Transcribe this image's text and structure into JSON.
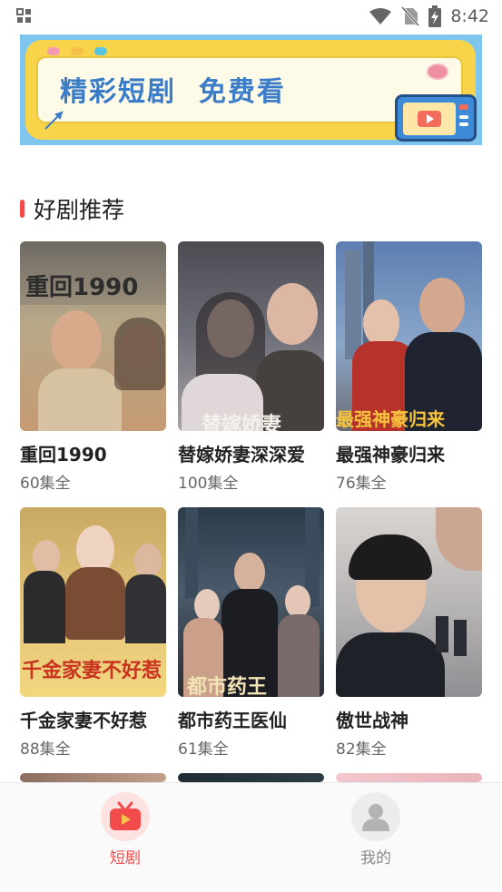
{
  "status_bar": {
    "time": "8:42",
    "icons": [
      "gallery-icon",
      "wifi-icon",
      "no-sim-icon",
      "battery-charging-icon"
    ]
  },
  "banner": {
    "text": "精彩短剧  免费看",
    "colors": {
      "frame": "#7fc6ee",
      "yellow": "#f8d44b",
      "text": "#3b7cc9"
    }
  },
  "section": {
    "title": "好剧推荐",
    "accent_color": "#f24b4b"
  },
  "dramas": [
    {
      "title": "重回1990",
      "episodes": "60集全",
      "poster_text": "重回1990"
    },
    {
      "title": "替嫁娇妻深深爱",
      "episodes": "100集全",
      "poster_text": "替嫁娇妻"
    },
    {
      "title": "最强神豪归来",
      "episodes": "76集全",
      "poster_text": "最强神豪归来"
    },
    {
      "title": "千金家妻不好惹",
      "episodes": "88集全",
      "poster_text": "千金家妻不好惹"
    },
    {
      "title": "都市药王医仙",
      "episodes": "61集全",
      "poster_text": "都市药王"
    },
    {
      "title": "傲世战神",
      "episodes": "82集全",
      "poster_text": ""
    }
  ],
  "tabbar": {
    "tabs": [
      {
        "label": "短剧",
        "active": true,
        "icon": "tv-play-icon",
        "color": "#f24b4b"
      },
      {
        "label": "我的",
        "active": false,
        "icon": "user-icon",
        "color": "#888888"
      }
    ]
  }
}
